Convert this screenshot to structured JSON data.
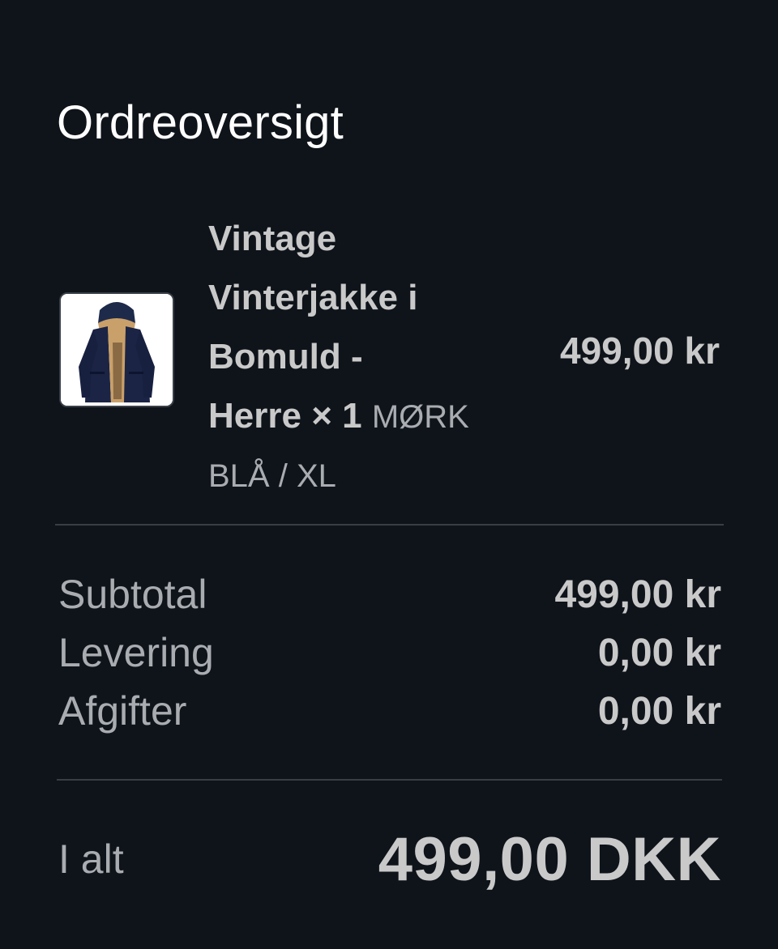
{
  "header": {
    "title": "Ordreoversigt"
  },
  "item": {
    "image_icon": "jacket-thumbnail",
    "name_line1": "Vintage",
    "name_line2": "Vinterjakke i",
    "name_line3": "Bomuld -",
    "name_line4": "Herre",
    "quantity": "× 1",
    "variant_part1": "MØRK",
    "variant_part2": "BLÅ / XL",
    "price": "499,00 kr"
  },
  "summary": {
    "subtotal_label": "Subtotal",
    "subtotal_value": "499,00 kr",
    "shipping_label": "Levering",
    "shipping_value": "0,00 kr",
    "tax_label": "Afgifter",
    "tax_value": "0,00 kr"
  },
  "total": {
    "label": "I alt",
    "value": "499,00 DKK"
  },
  "colors": {
    "background": "#0f141b",
    "title_text": "#ffffff",
    "primary_text": "#c9c9c9",
    "secondary_text": "#a9acb0",
    "divider": "#3a3e44"
  }
}
